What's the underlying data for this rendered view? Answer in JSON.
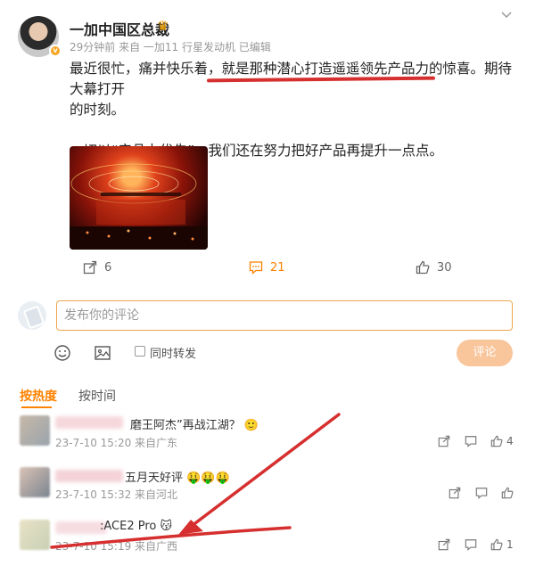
{
  "post": {
    "author": "一加中国区总裁",
    "meta": "29分钟前 来自 一加11 行星发动机 已编辑",
    "line1": "最近很忙，痛并快乐着，就是那种潜心打造遥遥领先产品力的惊喜。期待大幕打开",
    "line2": "的时刻。",
    "line3": "一切以“产品力优先”，我们还在努力把好产品再提升一点点。",
    "actions": {
      "reposts": "6",
      "comments": "21",
      "likes": "30"
    }
  },
  "composer": {
    "placeholder": "发布你的评论",
    "repost_label": "同时转发",
    "submit_label": "评论"
  },
  "tabs": {
    "hot": "按热度",
    "time": "按时间"
  },
  "comments": [
    {
      "text": "磨王阿杰”再战江湖？",
      "emoji": "🙂",
      "meta": "23-7-10 15:20 来自广东",
      "likes": "4"
    },
    {
      "text": "五月天好评",
      "emoji": "🤑🤑🤑",
      "meta": "23-7-10 15:32 来自河北",
      "likes": ""
    },
    {
      "text": ":ACE2 Pro",
      "emoji": "😽",
      "meta": "23-7-10 15:19 来自广西",
      "likes": "1"
    }
  ],
  "colors": {
    "accent": "#ff8200",
    "annotation_red": "#d62f2f",
    "input_border": "#f0a64f"
  }
}
